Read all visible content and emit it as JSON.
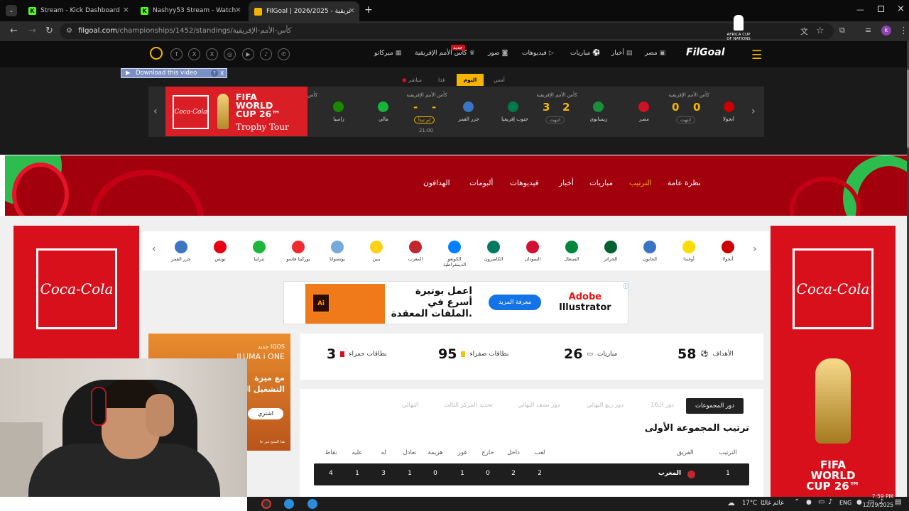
{
  "browser": {
    "tabs": [
      {
        "title": "Stream - Kick Dashboard",
        "icon": "kick-icon"
      },
      {
        "title": "Nashyy53 Stream - Watch Live",
        "icon": "kick-icon"
      },
      {
        "title": "FilGoal | 2026/2025 - كأس الأمم الإفريقية",
        "icon": "filgoal-icon"
      }
    ],
    "url_host": "filgoal.com",
    "url_path": "/championships/1452/standings/كأس-الأمم-الإفريقية"
  },
  "header": {
    "logo": "FilGoal",
    "nav": [
      "مصر",
      "أخبار",
      "مباريات",
      "فيديوهات",
      "صور",
      "كأس الأمم الإفريقية",
      "ميركاتو"
    ],
    "new_badge": "جديد",
    "socials": [
      "facebook",
      "x",
      "x",
      "instagram",
      "youtube",
      "tiktok",
      "whatsapp"
    ]
  },
  "download_bar": {
    "label": "Download this video",
    "help": "?",
    "close": "X"
  },
  "day_tabs": [
    "أمس",
    "اليوم",
    "غدا",
    "مباشر"
  ],
  "matches": [
    {
      "competition": "كأس الأمم الإفريقية",
      "home": "أنجولا",
      "away": "مصر",
      "home_score": "0",
      "away_score": "0",
      "status": "انتهت",
      "home_color": "#cc0000",
      "away_color": "#ce1126"
    },
    {
      "competition": "كأس الأمم الإفريقية",
      "home": "زيمبابوي",
      "away": "جنوب إفريقيا",
      "home_score": "2",
      "away_score": "3",
      "status": "انتهت",
      "home_color": "#1a8f3b",
      "away_color": "#007a4d"
    },
    {
      "competition": "كأس الأمم الإفريقية",
      "home": "جزر القمر",
      "away": "مالي",
      "home_score": "-",
      "away_score": "-",
      "status": "لم تبدأ",
      "time": "21:00",
      "home_color": "#3a75c4",
      "away_color": "#14b53a"
    },
    {
      "competition": "كأس",
      "home": "زامبيا",
      "away": "",
      "home_color": "#198a00"
    }
  ],
  "ad_top": {
    "brand": "Coca-Cola",
    "line1": "FIFA",
    "line2": "WORLD",
    "line3": "CUP 26™",
    "line4": "Trophy Tour"
  },
  "section_nav": [
    "نظرة عامة",
    "الترتيب",
    "مباريات",
    "أخبار",
    "فيديوهات",
    "ألبومات",
    "الهدافون"
  ],
  "afcon_logo": "AFRICA CUP OF NATIONS",
  "teams": [
    {
      "name": "أنجولا",
      "color": "#cc0000"
    },
    {
      "name": "أوغندا",
      "color": "#fcdc04"
    },
    {
      "name": "الجابون",
      "color": "#3a75c4"
    },
    {
      "name": "الجزائر",
      "color": "#006233"
    },
    {
      "name": "السنغال",
      "color": "#00853f"
    },
    {
      "name": "السودان",
      "color": "#d21034"
    },
    {
      "name": "الكاميرون",
      "color": "#007a5e"
    },
    {
      "name": "الكونغو الديمقراطية",
      "color": "#007fff"
    },
    {
      "name": "المغرب",
      "color": "#c1272d"
    },
    {
      "name": "بنين",
      "color": "#fcd116"
    },
    {
      "name": "بوتسوانا",
      "color": "#75aadb"
    },
    {
      "name": "بوركينا فاسو",
      "color": "#ef2b2d"
    },
    {
      "name": "تنزانيا",
      "color": "#1eb53a"
    },
    {
      "name": "تونس",
      "color": "#e70013"
    },
    {
      "name": "جزر القمر",
      "color": "#3a75c4"
    }
  ],
  "banner": {
    "text": "اعمل بوتيرة أسرع في الملفات المعقدة.",
    "button": "معرفة المزيد",
    "brand_line1": "Adobe",
    "brand_line2": "Illustrator"
  },
  "stats": [
    {
      "label": "الأهداف",
      "value": "58"
    },
    {
      "label": "مباريات",
      "value": "26"
    },
    {
      "label": "بطاقات صفراء",
      "value": "95"
    },
    {
      "label": "بطاقات حمراء",
      "value": "3"
    }
  ],
  "iqos": {
    "l1": "جديد IQOS",
    "l2": "ILUMA i ONE",
    "l3": "مع ميزة",
    "l4": "التشغيل الـ",
    "btn": "اشتري",
    "foot": "هذا المنتج غير خا"
  },
  "rounds": [
    "دور المجموعات",
    "دور الـ16",
    "دور ربع النهائي",
    "دور نصف النهائي",
    "تحديد المركز الثالث",
    "النهائي"
  ],
  "group_title": "ترتيب المجموعة الأولى",
  "table_headers": [
    "الترتيب",
    "الفريق",
    "لعب",
    "داخل",
    "خارج",
    "فوز",
    "هزيمة",
    "تعادل",
    "له",
    "عليه",
    "نقاط"
  ],
  "rows": [
    {
      "rank": "1",
      "team": "المغرب",
      "played": "2",
      "home": "2",
      "away": "0",
      "win": "1",
      "loss": "0",
      "draw": "1",
      "for": "3",
      "against": "1",
      "points": "4"
    }
  ],
  "right_ad": {
    "brand": "Coca-Cola",
    "l1": "FIFA",
    "l2": "WORLD",
    "l3": "CUP 26™"
  },
  "taskbar": {
    "weather": "17°C",
    "weather_text": "غائم غالبًا",
    "lang": "ENG",
    "time": "7:59 PM",
    "date": "12/29/2025"
  }
}
